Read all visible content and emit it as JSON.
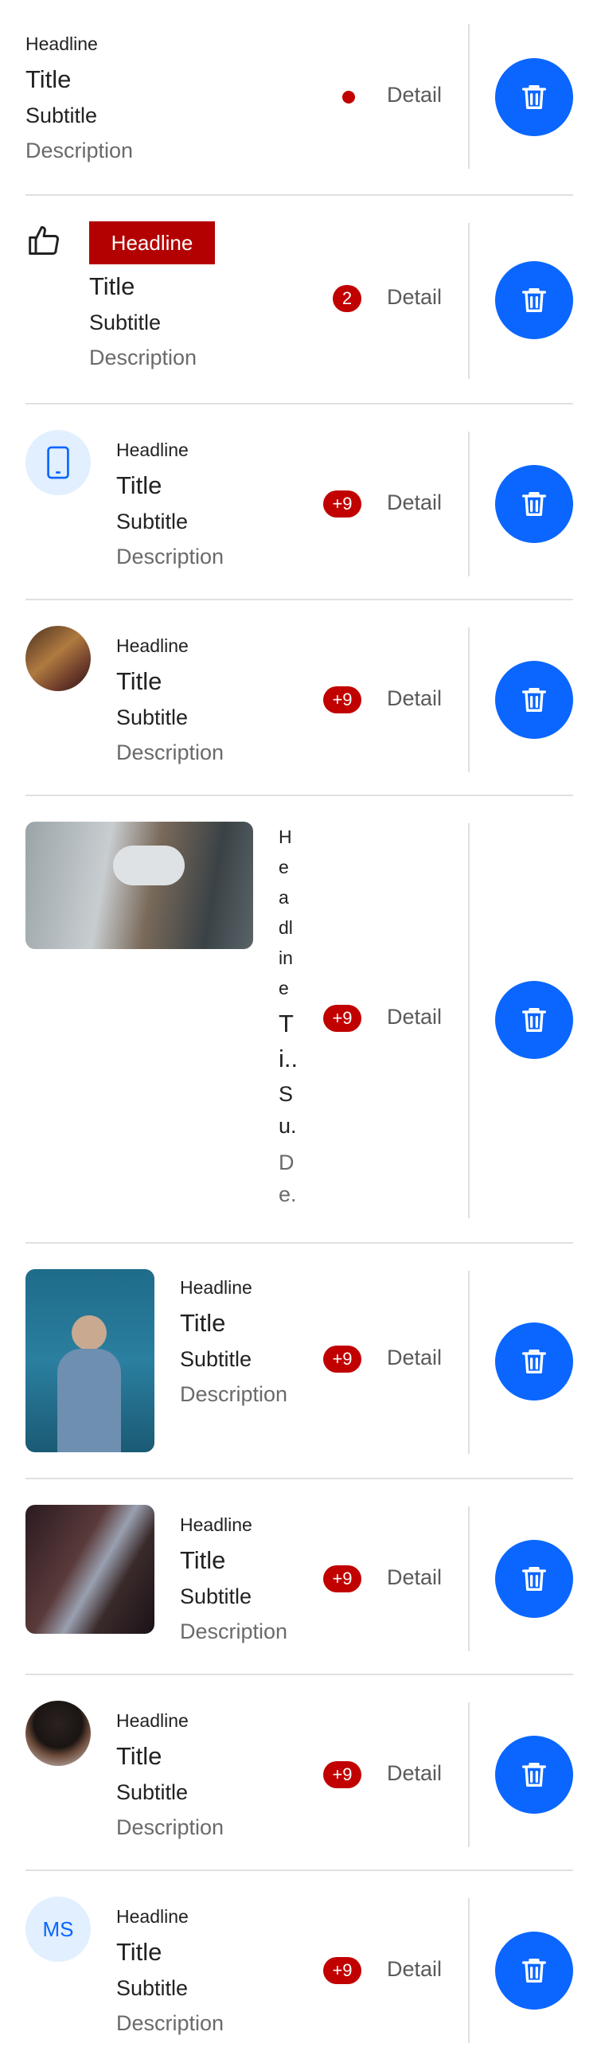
{
  "list": {
    "detail_label": "Detail",
    "items": [
      {
        "headline": "Headline",
        "title": "Title",
        "subtitle": "Subtitle",
        "description": "Description",
        "leading": "none",
        "trailing_badge": "dot"
      },
      {
        "headline": "Headline",
        "title": "Title",
        "subtitle": "Subtitle",
        "description": "Description",
        "leading": "thumbs-up-icon",
        "trailing_badge": "2"
      },
      {
        "headline": "Headline",
        "title": "Title",
        "subtitle": "Subtitle",
        "description": "Description",
        "leading": "mobile-phone-icon",
        "trailing_badge": "+9"
      },
      {
        "headline": "Headline",
        "title": "Title",
        "subtitle": "Subtitle",
        "description": "Description",
        "leading": "round-photo",
        "trailing_badge": "+9"
      },
      {
        "headline": "Headline",
        "title": "Ti..",
        "subtitle": "Su.",
        "description": "De.",
        "leading": "wide-photo",
        "trailing_badge": "+9",
        "headline_wrapped": [
          "H",
          "e",
          "a",
          "dl",
          "in",
          "e"
        ]
      },
      {
        "headline": "Headline",
        "title": "Title",
        "subtitle": "Subtitle",
        "description": "Description",
        "leading": "tall-photo",
        "trailing_badge": "+9"
      },
      {
        "headline": "Headline",
        "title": "Title",
        "subtitle": "Subtitle",
        "description": "Description",
        "leading": "square-photo",
        "trailing_badge": "+9"
      },
      {
        "headline": "Headline",
        "title": "Title",
        "subtitle": "Subtitle",
        "description": "Description",
        "leading": "avatar-photo",
        "trailing_badge": "+9"
      },
      {
        "headline": "Headline",
        "title": "Title",
        "subtitle": "Subtitle",
        "description": "Description",
        "leading": "initials",
        "initials": "MS",
        "trailing_badge": "+9"
      }
    ]
  },
  "colors": {
    "accent": "#0a66ff",
    "badge": "#c10000",
    "divider": "#e0e0e0"
  },
  "icons": {
    "delete": "trash-icon"
  }
}
